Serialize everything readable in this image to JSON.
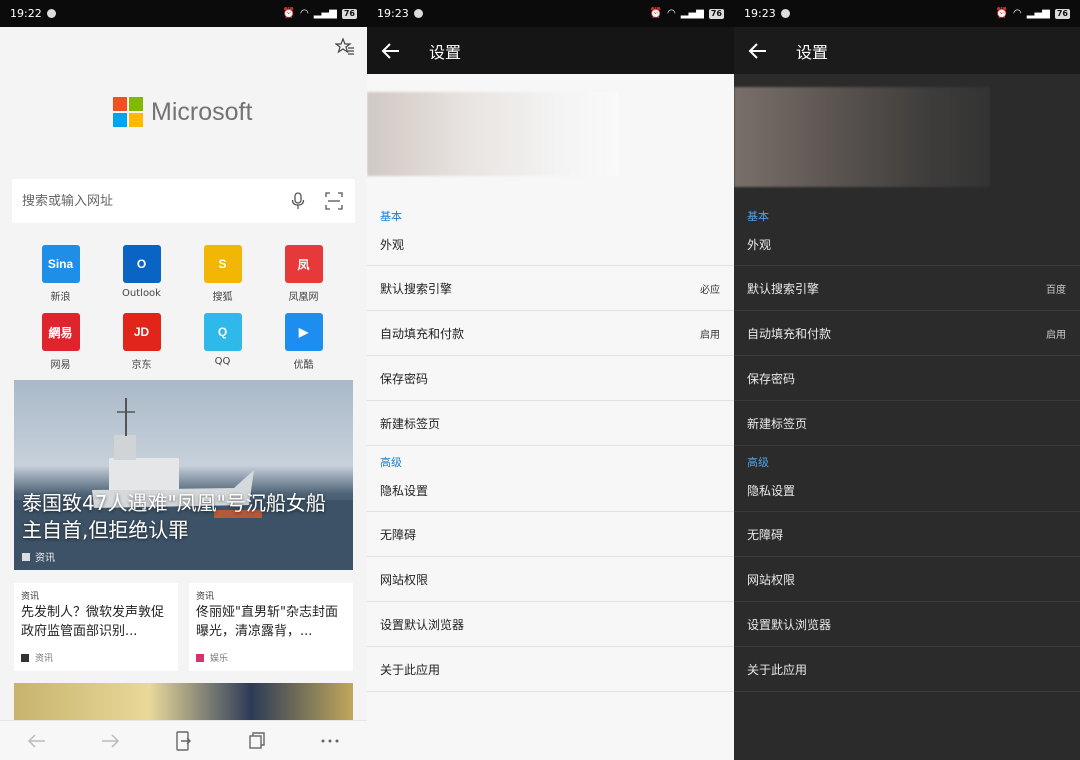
{
  "screen1": {
    "status": {
      "time": "19:22",
      "battery": "76"
    },
    "brand": {
      "name": "Microsoft",
      "colors": [
        "#f25022",
        "#7fba00",
        "#00a4ef",
        "#ffb900"
      ]
    },
    "search": {
      "placeholder": "搜索或输入网址"
    },
    "sites": [
      {
        "label": "新浪",
        "tile_text": "Sina",
        "color": "#1f8ee6",
        "icon": "sina-icon"
      },
      {
        "label": "Outlook",
        "tile_text": "O",
        "color": "#0a64c4",
        "icon": "outlook-icon"
      },
      {
        "label": "搜狐",
        "tile_text": "S",
        "color": "#f2b705",
        "icon": "sohu-icon"
      },
      {
        "label": "凤凰网",
        "tile_text": "凤",
        "color": "#e8393a",
        "icon": "ifeng-icon"
      },
      {
        "label": "网易",
        "tile_text": "網易",
        "color": "#e0242e",
        "icon": "netease-icon"
      },
      {
        "label": "京东",
        "tile_text": "JD",
        "color": "#e1251b",
        "icon": "jd-icon"
      },
      {
        "label": "QQ",
        "tile_text": "Q",
        "color": "#2fb8ea",
        "icon": "qq-icon"
      },
      {
        "label": "优酷",
        "tile_text": "▶",
        "color": "#1e8df0",
        "icon": "youku-icon"
      }
    ],
    "hero": {
      "title": "泰国致47人遇难\"凤凰\"号沉船女船主自首,但拒绝认罪",
      "source": "资讯"
    },
    "cards": [
      {
        "tag": "资讯",
        "title": "先发制人？微软发声敦促政府监管面部识别...",
        "source": "资讯",
        "color": "#333333"
      },
      {
        "tag": "资讯",
        "title": "佟丽娅\"直男斩\"杂志封面曝光，清凉露背，...",
        "source": "娱乐",
        "color": "#d6336c"
      }
    ]
  },
  "settings": {
    "status": {
      "time": "19:23",
      "battery": "76"
    },
    "title": "设置",
    "sections": {
      "basic": "基本",
      "advanced": "高级"
    },
    "light": {
      "basic_rows": [
        {
          "label": "外观",
          "value": ""
        },
        {
          "label": "默认搜索引擎",
          "value": "必应"
        },
        {
          "label": "自动填充和付款",
          "value": "启用"
        },
        {
          "label": "保存密码",
          "value": ""
        },
        {
          "label": "新建标签页",
          "value": ""
        }
      ],
      "advanced_rows": [
        {
          "label": "隐私设置"
        },
        {
          "label": "无障碍"
        },
        {
          "label": "网站权限"
        },
        {
          "label": "设置默认浏览器"
        },
        {
          "label": "关于此应用"
        }
      ]
    },
    "dark": {
      "basic_rows": [
        {
          "label": "外观",
          "value": ""
        },
        {
          "label": "默认搜索引擎",
          "value": "百度"
        },
        {
          "label": "自动填充和付款",
          "value": "启用"
        },
        {
          "label": "保存密码",
          "value": ""
        },
        {
          "label": "新建标签页",
          "value": ""
        }
      ],
      "advanced_rows": [
        {
          "label": "隐私设置"
        },
        {
          "label": "无障碍"
        },
        {
          "label": "网站权限"
        },
        {
          "label": "设置默认浏览器"
        },
        {
          "label": "关于此应用"
        }
      ]
    }
  }
}
